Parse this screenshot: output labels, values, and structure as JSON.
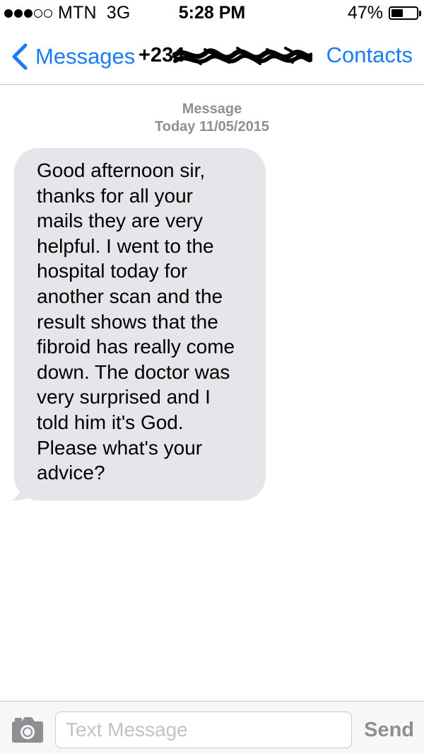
{
  "status_bar": {
    "signal_dots": {
      "filled": 3,
      "total": 5
    },
    "carrier": "MTN",
    "network": "3G",
    "time": "5:28 PM",
    "battery_percent_text": "47%",
    "battery_level": 0.47
  },
  "nav": {
    "back_label": "Messages",
    "title": "+234",
    "contacts_label": "Contacts"
  },
  "conversation": {
    "service": "Message",
    "date": "Today 11/05/2015"
  },
  "message": {
    "direction": "incoming",
    "lines": [
      "Good afternoon sir,",
      "thanks for all your",
      "mails they are very",
      "helpful. I went to the",
      "hospital today for",
      "another scan and the",
      "result shows that the",
      "fibroid has really come",
      "down. The doctor was",
      "very surprised and I",
      "told him it's God.",
      "Please what's your",
      "advice?"
    ]
  },
  "input_bar": {
    "placeholder": "Text Message",
    "send_label": "Send"
  },
  "colors": {
    "accent": "#1a7cf5",
    "bubble_incoming": "#e5e5ea",
    "secondary_text": "#8e8e93"
  },
  "icons": {
    "back": "chevron-left-icon",
    "camera": "camera-icon",
    "battery": "battery-icon",
    "signal": "signal-dots-icon"
  }
}
